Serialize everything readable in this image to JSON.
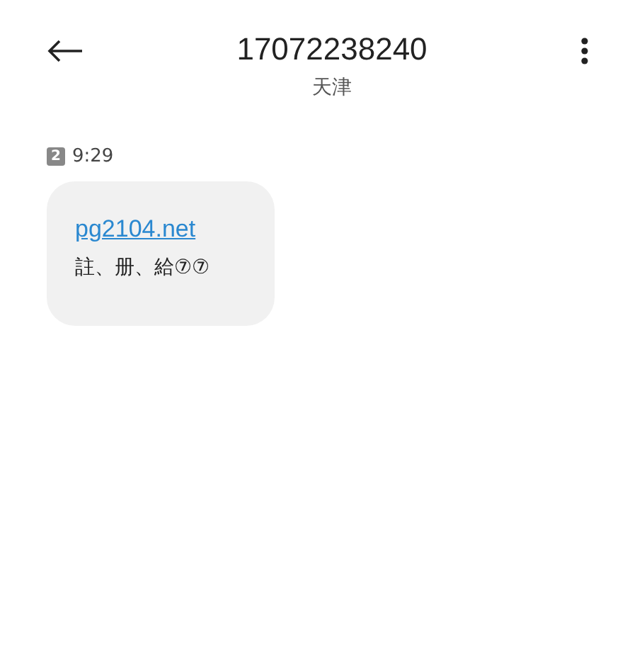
{
  "header": {
    "title": "17072238240",
    "subtitle": "天津"
  },
  "messages": [
    {
      "sim": "2",
      "time": "9:29",
      "link": "pg2104.net",
      "text": "註、册、給⑦⑦"
    }
  ]
}
